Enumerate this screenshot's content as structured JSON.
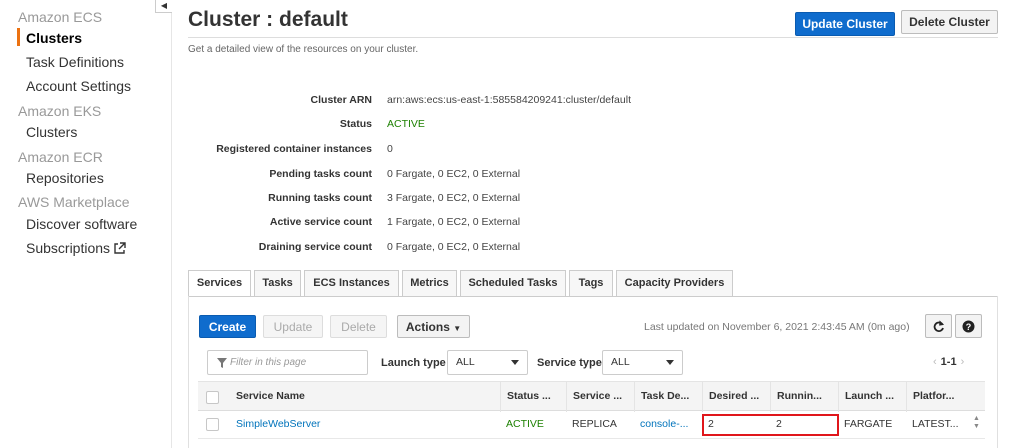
{
  "sidebar": {
    "groups": [
      {
        "title": "Amazon ECS",
        "items": [
          {
            "label": "Clusters",
            "active": true
          },
          {
            "label": "Task Definitions"
          },
          {
            "label": "Account Settings"
          }
        ]
      },
      {
        "title": "Amazon EKS",
        "items": [
          {
            "label": "Clusters"
          }
        ]
      },
      {
        "title": "Amazon ECR",
        "items": [
          {
            "label": "Repositories"
          }
        ]
      },
      {
        "title": "AWS Marketplace",
        "items": [
          {
            "label": "Discover software"
          },
          {
            "label": "Subscriptions"
          }
        ]
      }
    ]
  },
  "header": {
    "title": "Cluster : default",
    "subtitle": "Get a detailed view of the resources on your cluster.",
    "update_button": "Update Cluster",
    "delete_button": "Delete Cluster"
  },
  "details": [
    {
      "label": "Cluster ARN",
      "value": "arn:aws:ecs:us-east-1:585584209241:cluster/default"
    },
    {
      "label": "Status",
      "value": "ACTIVE"
    },
    {
      "label": "Registered container instances",
      "value": "0"
    },
    {
      "label": "Pending tasks count",
      "value": "0 Fargate, 0 EC2, 0 External"
    },
    {
      "label": "Running tasks count",
      "value": "3 Fargate, 0 EC2, 0 External"
    },
    {
      "label": "Active service count",
      "value": "1 Fargate, 0 EC2, 0 External"
    },
    {
      "label": "Draining service count",
      "value": "0 Fargate, 0 EC2, 0 External"
    }
  ],
  "tabs": [
    "Services",
    "Tasks",
    "ECS Instances",
    "Metrics",
    "Scheduled Tasks",
    "Tags",
    "Capacity Providers"
  ],
  "toolbar": {
    "create": "Create",
    "update": "Update",
    "delete": "Delete",
    "actions": "Actions",
    "last_updated": "Last updated on November 6, 2021 2:43:45 AM (0m ago)"
  },
  "filters": {
    "placeholder": "Filter in this page",
    "launch_type_label": "Launch type",
    "launch_type_value": "ALL",
    "service_type_label": "Service type",
    "service_type_value": "ALL",
    "page_range": "1-1"
  },
  "table": {
    "columns": [
      "Service Name",
      "Status ...",
      "Service ...",
      "Task De...",
      "Desired ...",
      "Runnin...",
      "Launch ...",
      "Platfor..."
    ],
    "rows": [
      [
        "SimpleWebServer",
        "ACTIVE",
        "REPLICA",
        "console-...",
        "2",
        "2",
        "FARGATE",
        "LATEST..."
      ]
    ]
  },
  "colors": {
    "primary": "#0f6ccd",
    "active_accent": "#ec7211",
    "status_green": "#1d8102",
    "link": "#0073bb",
    "highlight": "#e0161b"
  }
}
